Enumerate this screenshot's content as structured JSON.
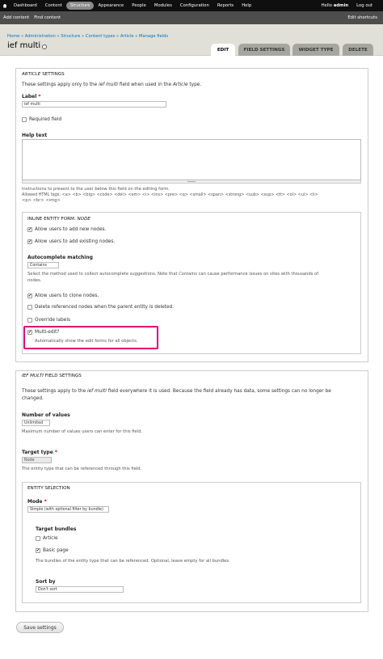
{
  "toolbar": {
    "items": [
      "Dashboard",
      "Content",
      "Structure",
      "Appearance",
      "People",
      "Modules",
      "Configuration",
      "Reports",
      "Help"
    ],
    "user_greeting": "Hello",
    "user_name": "admin",
    "logout": "Log out"
  },
  "shortcuts": {
    "items": [
      "Add content",
      "Find content"
    ],
    "edit": "Edit shortcuts"
  },
  "breadcrumb": "Home » Administration » Structure » Content types » Article » Manage fields",
  "page_title": "ief multi",
  "tabs": [
    "EDIT",
    "FIELD SETTINGS",
    "WIDGET TYPE",
    "DELETE"
  ],
  "article_settings": {
    "legend_em": "ARTICLE",
    "legend_rest": " SETTINGS",
    "intro_pre": "These settings apply only to the ",
    "intro_em1": "ief multi",
    "intro_mid": " field when used in the ",
    "intro_em2": "Article",
    "intro_post": " type.",
    "label_label": "Label",
    "label_value": "ief multi",
    "required_label": "Required field",
    "help_label": "Help text",
    "help_desc1": "Instructions to present to the user below this field on the editing form.",
    "help_desc2": "Allowed HTML tags: <a> <b> <big> <code> <del> <em> <i> <ins> <pre> <q> <small> <span> <strong> <sub> <sup> <tt> <ol> <ul> <li>",
    "help_desc3": "<p> <br> <img>"
  },
  "ief": {
    "legend_pre": "INLINE ENTITY FORM: ",
    "legend_em": "NODE",
    "allow_add_new": "Allow users to add new nodes.",
    "allow_add_existing": "Allow users to add existing nodes.",
    "autocomplete_label": "Autocomplete matching",
    "autocomplete_value": "Contains",
    "autocomplete_desc1_pre": "Select the method used to collect autocomplete suggestions. Note that ",
    "autocomplete_desc1_em": "Contains",
    "autocomplete_desc1_post": " can cause performance issues on sites with thousands of",
    "autocomplete_desc2": "nodes.",
    "allow_clone": "Allow users to clone nodes.",
    "delete_referenced": "Delete referenced nodes when the parent entity is deleted.",
    "override_labels": "Override labels",
    "multi_edit": "Multi-edit?",
    "multi_edit_desc": "Automatically show the edit forms for all objects."
  },
  "field_settings": {
    "legend_em": "IEF MULTI",
    "legend_rest": " FIELD SETTINGS",
    "intro1_pre": "These settings apply to the ",
    "intro1_em": "ief multi",
    "intro1_post": " field everywhere it is used. Because the field already has data, some settings can no longer be",
    "intro2": "changed.",
    "num_values_label": "Number of values",
    "num_values_value": "Unlimited",
    "num_values_desc": "Maximum number of values users can enter for this field.",
    "target_type_label": "Target type",
    "target_type_value": "Node",
    "target_type_desc": "The entity type that can be referenced through this field."
  },
  "entity_selection": {
    "legend": "ENTITY SELECTION",
    "mode_label": "Mode",
    "mode_value": "Simple (with optional filter by bundle)",
    "bundles_label": "Target bundles",
    "bundle_article": "Article",
    "bundle_basic_page": "Basic page",
    "bundles_desc": "The bundles of the entity type that can be referenced. Optional, leave empty for all bundles.",
    "sort_label": "Sort by",
    "sort_value": "Don't sort"
  },
  "save_button": "Save settings",
  "required_mark": "*",
  "check_mark": "✔"
}
